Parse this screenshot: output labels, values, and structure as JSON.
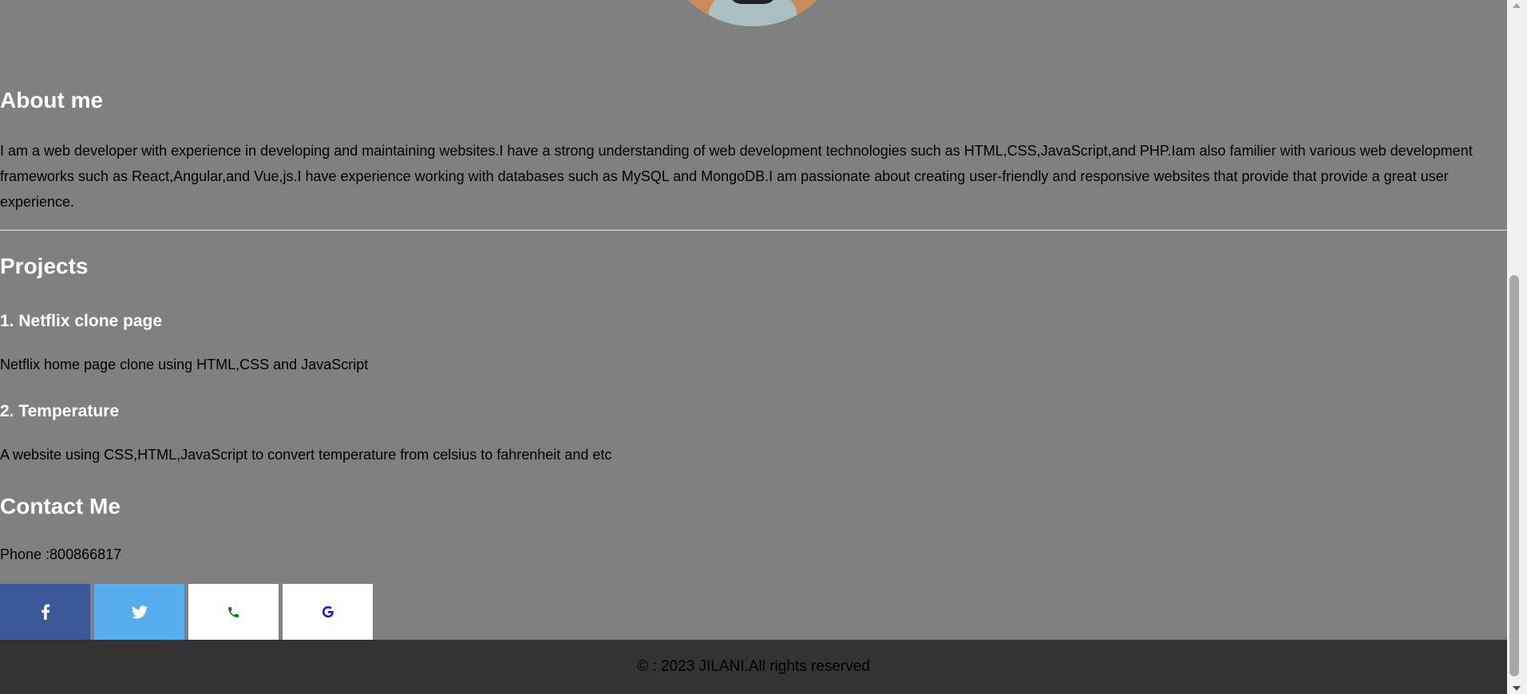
{
  "about": {
    "title": "About me",
    "text": "I am a web developer with experience in developing and maintaining websites.I have a strong understanding of web development technologies such as HTML,CSS,JavaScript,and PHP.Iam also familier with various web development frameworks such as React,Angular,and Vue,js.I have experience working with databases such as MySQL and MongoDB.I am passionate about creating user-friendly and responsive websites that provide that provide a great user experience."
  },
  "projects": {
    "title": "Projects",
    "items": [
      {
        "title": "1. Netflix clone page",
        "description": "Netflix home page clone using HTML,CSS and JavaScript"
      },
      {
        "title": "2. Temperature",
        "description": "A website using CSS,HTML,JavaScript to convert temperature from celsius to fahrenheit and etc"
      }
    ]
  },
  "contact": {
    "title": "Contact Me",
    "phone": "Phone :800866817",
    "social": [
      {
        "name": "facebook",
        "icon": "facebook-icon",
        "color": "#3b5998"
      },
      {
        "name": "twitter",
        "icon": "twitter-icon",
        "color": "#55acee"
      },
      {
        "name": "phone",
        "icon": "phone-icon",
        "color": "#ffffff"
      },
      {
        "name": "google",
        "icon": "google-icon",
        "color": "#ffffff"
      }
    ]
  },
  "footer": {
    "text": "© : 2023 JILANI.All rights reserved"
  }
}
